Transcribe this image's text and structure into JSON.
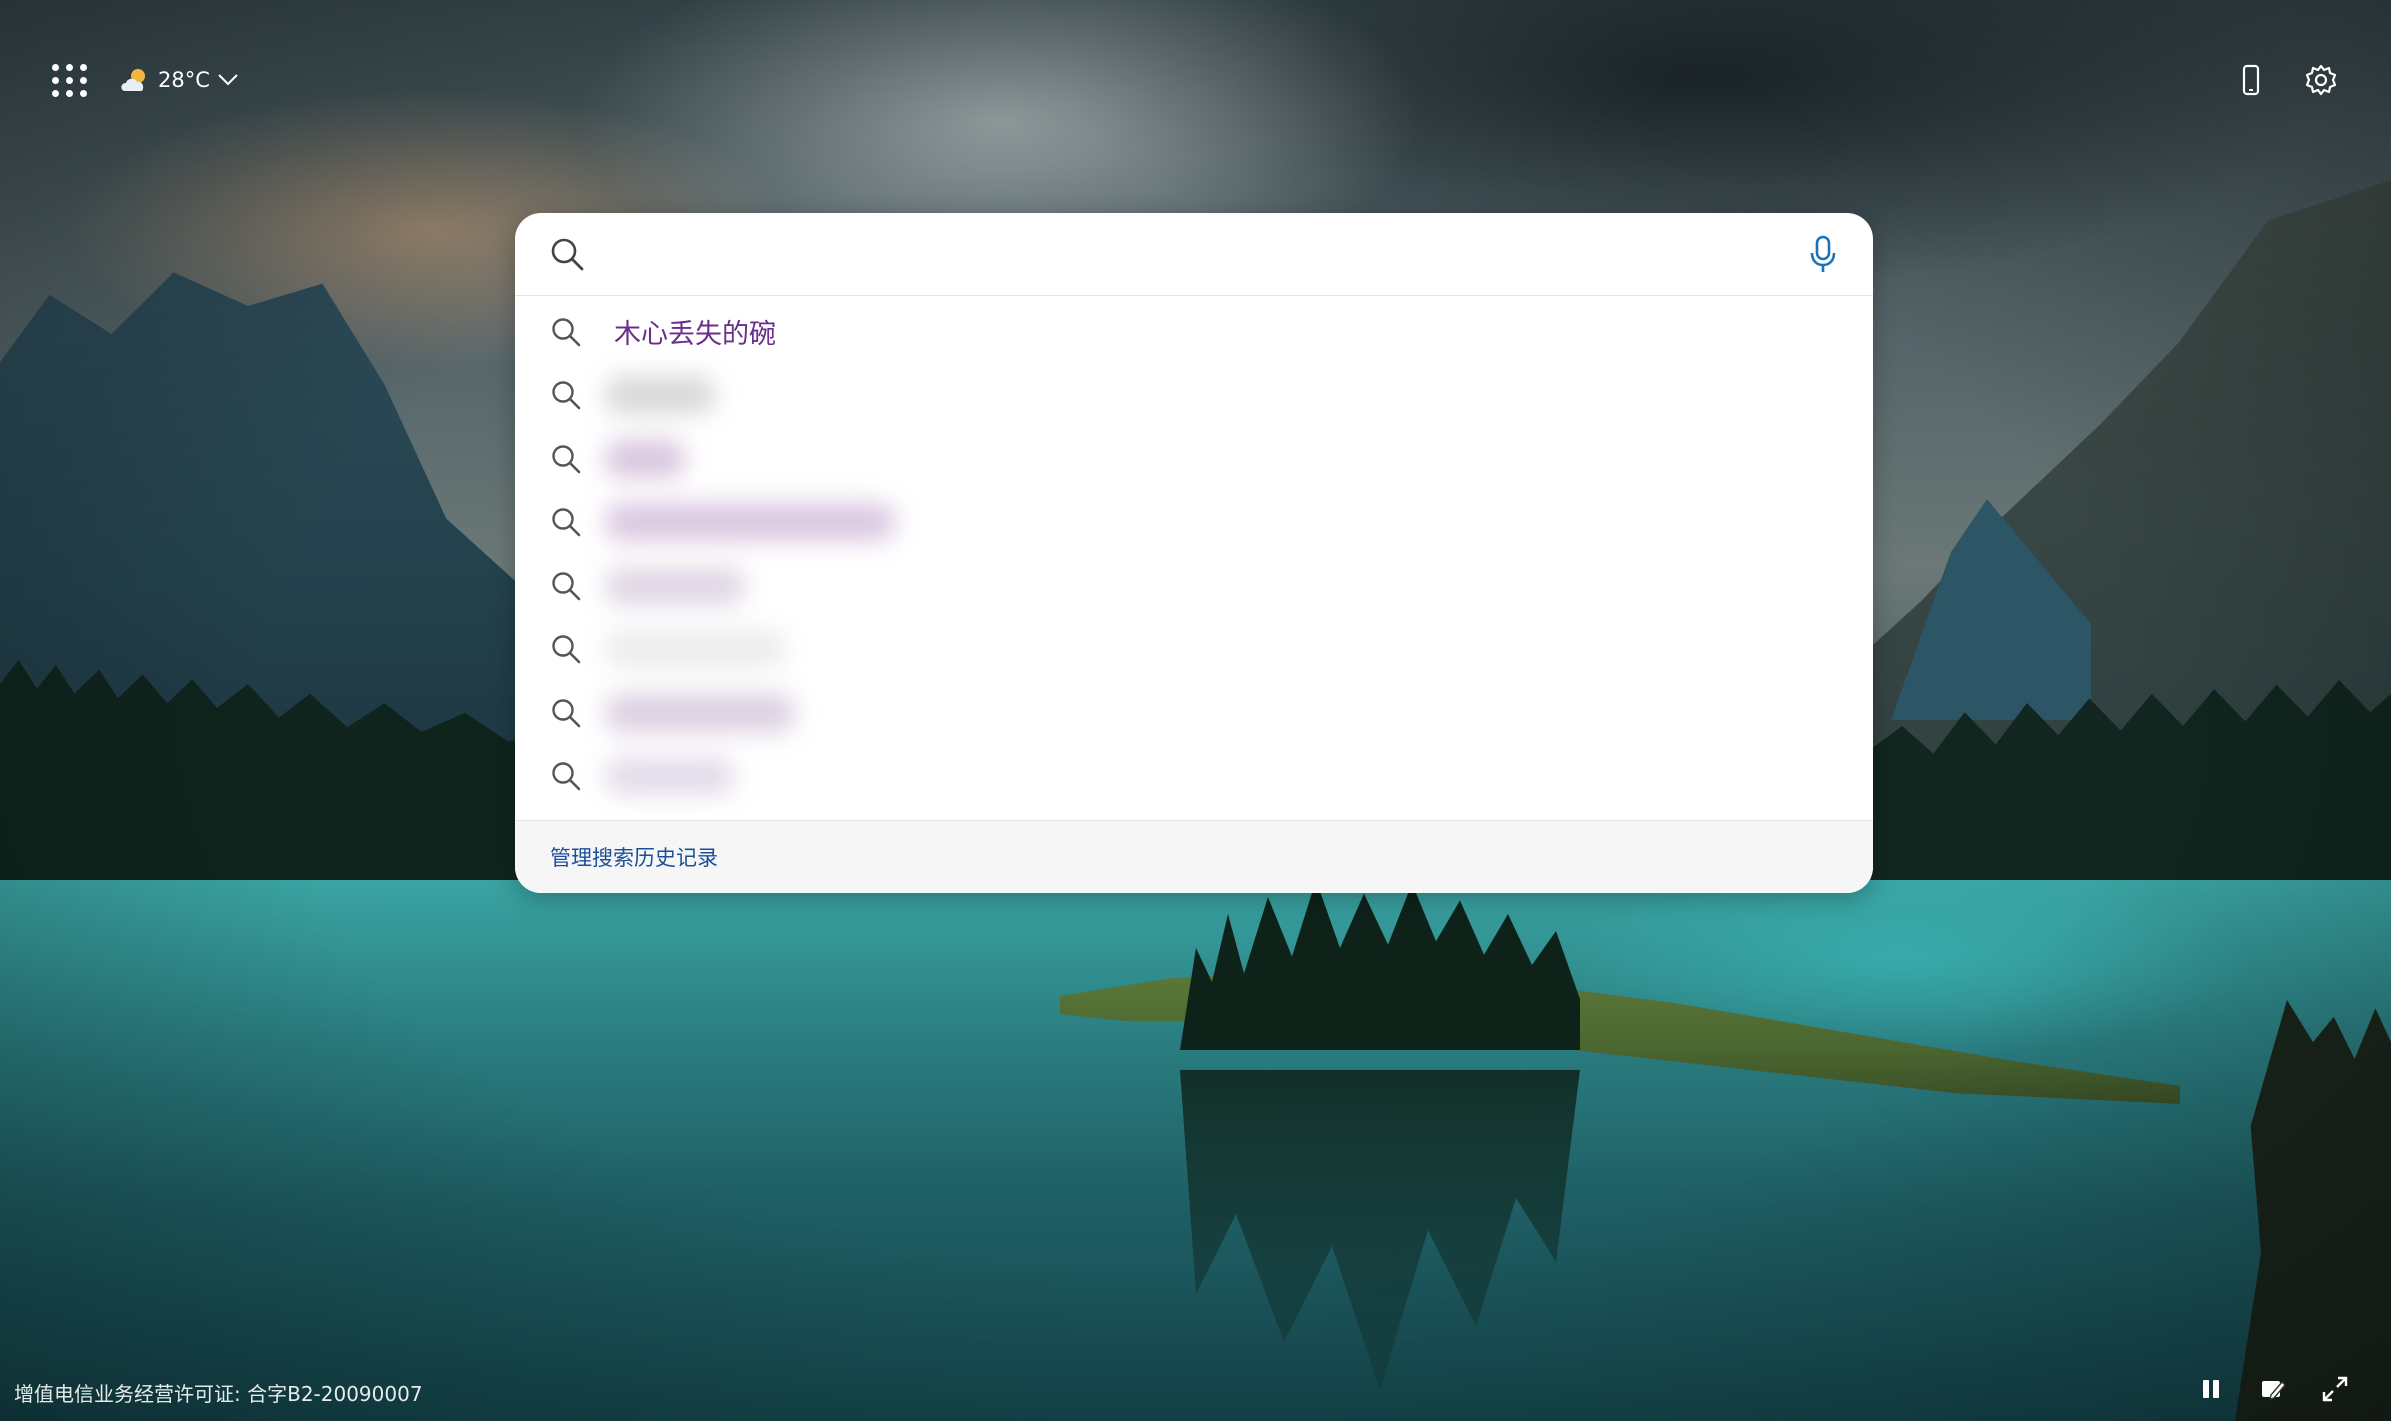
{
  "topbar": {
    "apps_icon": "apps-grid-icon",
    "weather": {
      "icon": "partly-cloudy-icon",
      "temperature": "28°C",
      "dropdown_icon": "chevron-down-icon"
    },
    "mobile_icon": "mobile-phone-icon",
    "settings_icon": "gear-icon"
  },
  "search": {
    "placeholder": "",
    "value": "",
    "search_icon": "search-icon",
    "mic_icon": "microphone-icon",
    "suggestions": [
      {
        "text": "木心丢失的碗",
        "icon": "search-icon"
      },
      {
        "text": "",
        "icon": "search-icon"
      },
      {
        "text": "",
        "icon": "search-icon"
      },
      {
        "text": "",
        "icon": "search-icon"
      },
      {
        "text": "",
        "icon": "search-icon"
      },
      {
        "text": "",
        "icon": "search-icon"
      },
      {
        "text": "",
        "icon": "search-icon"
      },
      {
        "text": "",
        "icon": "search-icon"
      }
    ],
    "manage_history_label": "管理搜索历史记录"
  },
  "footer": {
    "license_text": "增值电信业务经营许可证: 合字B2-20090007",
    "pause_icon": "pause-icon",
    "edit_icon": "edit-image-icon",
    "fullscreen_icon": "expand-icon"
  },
  "colors": {
    "suggestion_text": "#6a2f8c",
    "link": "#1a4f9a",
    "mic_accent": "#1a73b8"
  }
}
